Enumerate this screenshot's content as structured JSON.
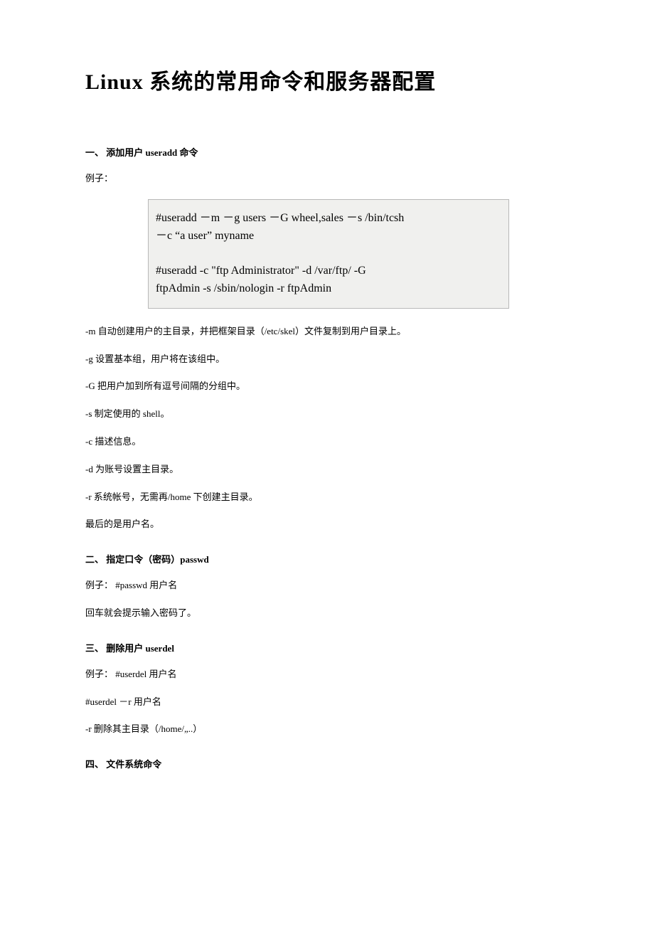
{
  "title": "Linux 系统的常用命令和服务器配置",
  "sections": {
    "s1": {
      "heading": "一、 添加用户 useradd 命令",
      "exlabel": "例子：",
      "code": "#useradd －m －g users －G wheel,sales －s /bin/tcsh\n－c “a user” myname\n\n#useradd -c \"ftp Administrator\" -d /var/ftp/ -G\nftpAdmin -s /sbin/nologin -r ftpAdmin",
      "opts": {
        "m": "-m 自动创建用户的主目录，并把框架目录（/etc/skel）文件复制到用户目录上。",
        "g": "-g 设置基本组，用户将在该组中。",
        "G": "-G 把用户加到所有逗号间隔的分组中。",
        "s": "-s 制定使用的 shell。",
        "c": "-c 描述信息。",
        "d": "-d 为账号设置主目录。",
        "r": "-r 系统帐号，无需再/home 下创建主目录。"
      },
      "last": "最后的是用户名。"
    },
    "s2": {
      "heading": "二、 指定口令（密码）passwd",
      "p1": "例子： #passwd 用户名",
      "p2": "回车就会提示输入密码了。"
    },
    "s3": {
      "heading": "三、 删除用户 userdel",
      "p1": "例子： #userdel 用户名",
      "p2": "#userdel －r 用户名",
      "p3": "-r 删除其主目录（/home/„..）"
    },
    "s4": {
      "heading": "四、 文件系统命令"
    }
  }
}
